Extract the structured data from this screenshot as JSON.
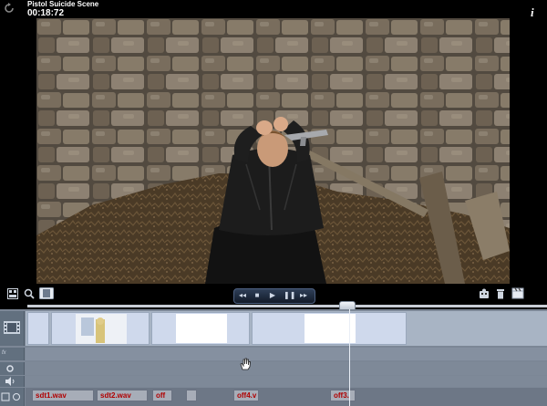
{
  "header": {
    "title": "Pistol Suicide Scene",
    "timecode": "00:18:72",
    "info_label": "i"
  },
  "icons": {
    "refresh": "refresh-icon",
    "info": "info-icon",
    "storyboard": "storyboard-icon",
    "zoom": "zoom-icon",
    "film": "film-icon",
    "character": "character-icon",
    "trash": "trash-icon",
    "clapper": "clapperboard-icon"
  },
  "transport": {
    "rewind": "◂◂",
    "stop": "■",
    "play": "▶",
    "pause": "❚❚",
    "forward": "▸▸"
  },
  "timeline": {
    "fx_track_label": "fx",
    "playhead_fraction": 0.62,
    "audio_clips": [
      "sdt1.wav",
      "sdt2.wav",
      "off",
      "off4.v",
      "off3."
    ]
  },
  "colors": {
    "background": "#000000",
    "timeline": "#7c8796",
    "audio_text": "#b10000"
  }
}
